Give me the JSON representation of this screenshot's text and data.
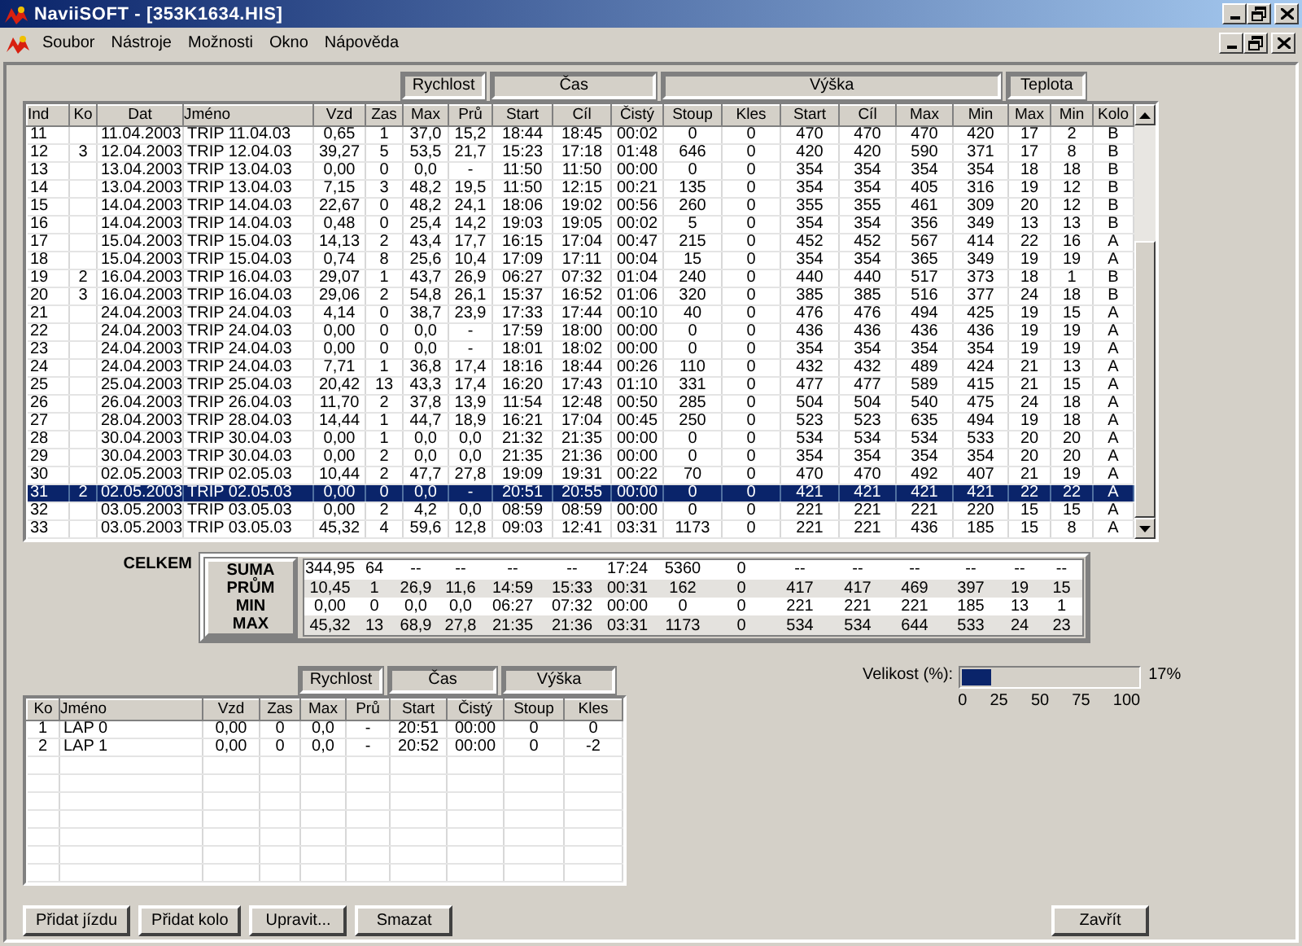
{
  "window": {
    "title": "NaviiSOFT - [353K1634.HIS]"
  },
  "menu": [
    "Soubor",
    "Nástroje",
    "Možnosti",
    "Okno",
    "Nápověda"
  ],
  "trips": {
    "groups": [
      "Rychlost",
      "Čas",
      "Výška",
      "Teplota"
    ],
    "columns": [
      "Ind",
      "Ko",
      "Dat",
      "Jméno",
      "Vzd",
      "Zas",
      "Max",
      "Prů",
      "Start",
      "Cíl",
      "Čistý",
      "Stoup",
      "Kles",
      "Start",
      "Cíl",
      "Max",
      "Min",
      "Max",
      "Min",
      "Kolo"
    ],
    "rows": [
      {
        "selected": false,
        "cells": [
          "11",
          null,
          "11.04.2003",
          "TRIP 11.04.03",
          "0,65",
          "1",
          "37,0",
          "15,2",
          "18:44",
          "18:45",
          "00:02",
          "0",
          "0",
          "470",
          "470",
          "470",
          "420",
          "17",
          "2",
          "B"
        ]
      },
      {
        "selected": false,
        "cells": [
          "12",
          "3",
          "12.04.2003",
          "TRIP 12.04.03",
          "39,27",
          "5",
          "53,5",
          "21,7",
          "15:23",
          "17:18",
          "01:48",
          "646",
          "0",
          "420",
          "420",
          "590",
          "371",
          "17",
          "8",
          "B"
        ]
      },
      {
        "selected": false,
        "cells": [
          "13",
          null,
          "13.04.2003",
          "TRIP 13.04.03",
          "0,00",
          "0",
          "0,0",
          "-",
          "11:50",
          "11:50",
          "00:00",
          "0",
          "0",
          "354",
          "354",
          "354",
          "354",
          "18",
          "18",
          "B"
        ]
      },
      {
        "selected": false,
        "cells": [
          "14",
          null,
          "13.04.2003",
          "TRIP 13.04.03",
          "7,15",
          "3",
          "48,2",
          "19,5",
          "11:50",
          "12:15",
          "00:21",
          "135",
          "0",
          "354",
          "354",
          "405",
          "316",
          "19",
          "12",
          "B"
        ]
      },
      {
        "selected": false,
        "cells": [
          "15",
          null,
          "14.04.2003",
          "TRIP 14.04.03",
          "22,67",
          "0",
          "48,2",
          "24,1",
          "18:06",
          "19:02",
          "00:56",
          "260",
          "0",
          "355",
          "355",
          "461",
          "309",
          "20",
          "12",
          "B"
        ]
      },
      {
        "selected": false,
        "cells": [
          "16",
          null,
          "14.04.2003",
          "TRIP 14.04.03",
          "0,48",
          "0",
          "25,4",
          "14,2",
          "19:03",
          "19:05",
          "00:02",
          "5",
          "0",
          "354",
          "354",
          "356",
          "349",
          "13",
          "13",
          "B"
        ]
      },
      {
        "selected": false,
        "cells": [
          "17",
          null,
          "15.04.2003",
          "TRIP 15.04.03",
          "14,13",
          "2",
          "43,4",
          "17,7",
          "16:15",
          "17:04",
          "00:47",
          "215",
          "0",
          "452",
          "452",
          "567",
          "414",
          "22",
          "16",
          "A"
        ]
      },
      {
        "selected": false,
        "cells": [
          "18",
          null,
          "15.04.2003",
          "TRIP 15.04.03",
          "0,74",
          "8",
          "25,6",
          "10,4",
          "17:09",
          "17:11",
          "00:04",
          "15",
          "0",
          "354",
          "354",
          "365",
          "349",
          "19",
          "19",
          "A"
        ]
      },
      {
        "selected": false,
        "cells": [
          "19",
          "2",
          "16.04.2003",
          "TRIP 16.04.03",
          "29,07",
          "1",
          "43,7",
          "26,9",
          "06:27",
          "07:32",
          "01:04",
          "240",
          "0",
          "440",
          "440",
          "517",
          "373",
          "18",
          "1",
          "B"
        ]
      },
      {
        "selected": false,
        "cells": [
          "20",
          "3",
          "16.04.2003",
          "TRIP 16.04.03",
          "29,06",
          "2",
          "54,8",
          "26,1",
          "15:37",
          "16:52",
          "01:06",
          "320",
          "0",
          "385",
          "385",
          "516",
          "377",
          "24",
          "18",
          "B"
        ]
      },
      {
        "selected": false,
        "cells": [
          "21",
          null,
          "24.04.2003",
          "TRIP 24.04.03",
          "4,14",
          "0",
          "38,7",
          "23,9",
          "17:33",
          "17:44",
          "00:10",
          "40",
          "0",
          "476",
          "476",
          "494",
          "425",
          "19",
          "15",
          "A"
        ]
      },
      {
        "selected": false,
        "cells": [
          "22",
          null,
          "24.04.2003",
          "TRIP 24.04.03",
          "0,00",
          "0",
          "0,0",
          "-",
          "17:59",
          "18:00",
          "00:00",
          "0",
          "0",
          "436",
          "436",
          "436",
          "436",
          "19",
          "19",
          "A"
        ]
      },
      {
        "selected": false,
        "cells": [
          "23",
          null,
          "24.04.2003",
          "TRIP 24.04.03",
          "0,00",
          "0",
          "0,0",
          "-",
          "18:01",
          "18:02",
          "00:00",
          "0",
          "0",
          "354",
          "354",
          "354",
          "354",
          "19",
          "19",
          "A"
        ]
      },
      {
        "selected": false,
        "cells": [
          "24",
          null,
          "24.04.2003",
          "TRIP 24.04.03",
          "7,71",
          "1",
          "36,8",
          "17,4",
          "18:16",
          "18:44",
          "00:26",
          "110",
          "0",
          "432",
          "432",
          "489",
          "424",
          "21",
          "13",
          "A"
        ]
      },
      {
        "selected": false,
        "cells": [
          "25",
          null,
          "25.04.2003",
          "TRIP 25.04.03",
          "20,42",
          "13",
          "43,3",
          "17,4",
          "16:20",
          "17:43",
          "01:10",
          "331",
          "0",
          "477",
          "477",
          "589",
          "415",
          "21",
          "15",
          "A"
        ]
      },
      {
        "selected": false,
        "cells": [
          "26",
          null,
          "26.04.2003",
          "TRIP 26.04.03",
          "11,70",
          "2",
          "37,8",
          "13,9",
          "11:54",
          "12:48",
          "00:50",
          "285",
          "0",
          "504",
          "504",
          "540",
          "475",
          "24",
          "18",
          "A"
        ]
      },
      {
        "selected": false,
        "cells": [
          "27",
          null,
          "28.04.2003",
          "TRIP 28.04.03",
          "14,44",
          "1",
          "44,7",
          "18,9",
          "16:21",
          "17:04",
          "00:45",
          "250",
          "0",
          "523",
          "523",
          "635",
          "494",
          "19",
          "18",
          "A"
        ]
      },
      {
        "selected": false,
        "cells": [
          "28",
          null,
          "30.04.2003",
          "TRIP 30.04.03",
          "0,00",
          "1",
          "0,0",
          "0,0",
          "21:32",
          "21:35",
          "00:00",
          "0",
          "0",
          "534",
          "534",
          "534",
          "533",
          "20",
          "20",
          "A"
        ]
      },
      {
        "selected": false,
        "cells": [
          "29",
          null,
          "30.04.2003",
          "TRIP 30.04.03",
          "0,00",
          "2",
          "0,0",
          "0,0",
          "21:35",
          "21:36",
          "00:00",
          "0",
          "0",
          "354",
          "354",
          "354",
          "354",
          "20",
          "20",
          "A"
        ]
      },
      {
        "selected": false,
        "cells": [
          "30",
          null,
          "02.05.2003",
          "TRIP 02.05.03",
          "10,44",
          "2",
          "47,7",
          "27,8",
          "19:09",
          "19:31",
          "00:22",
          "70",
          "0",
          "470",
          "470",
          "492",
          "407",
          "21",
          "19",
          "A"
        ]
      },
      {
        "selected": true,
        "cells": [
          "31",
          "2",
          "02.05.2003",
          "TRIP 02.05.03",
          "0,00",
          "0",
          "0,0",
          "-",
          "20:51",
          "20:55",
          "00:00",
          "0",
          "0",
          "421",
          "421",
          "421",
          "421",
          "22",
          "22",
          "A"
        ]
      },
      {
        "selected": false,
        "cells": [
          "32",
          null,
          "03.05.2003",
          "TRIP 03.05.03",
          "0,00",
          "2",
          "4,2",
          "0,0",
          "08:59",
          "08:59",
          "00:00",
          "0",
          "0",
          "221",
          "221",
          "221",
          "220",
          "15",
          "15",
          "A"
        ]
      },
      {
        "selected": false,
        "cells": [
          "33",
          null,
          "03.05.2003",
          "TRIP 03.05.03",
          "45,32",
          "4",
          "59,6",
          "12,8",
          "09:03",
          "12:41",
          "03:31",
          "1173",
          "0",
          "221",
          "221",
          "436",
          "185",
          "15",
          "8",
          "A"
        ]
      }
    ]
  },
  "totals": {
    "title": "CELKEM",
    "rows": [
      {
        "label": "SUMA",
        "values": [
          "344,95",
          "64",
          "--",
          "--",
          "--",
          "--",
          "17:24",
          "5360",
          "0",
          "--",
          "--",
          "--",
          "--",
          "--",
          "--"
        ]
      },
      {
        "label": "PRŮM",
        "values": [
          "10,45",
          "1",
          "26,9",
          "11,6",
          "14:59",
          "15:33",
          "00:31",
          "162",
          "0",
          "417",
          "417",
          "469",
          "397",
          "19",
          "15"
        ]
      },
      {
        "label": "MIN",
        "values": [
          "0,00",
          "0",
          "0,0",
          "0,0",
          "06:27",
          "07:32",
          "00:00",
          "0",
          "0",
          "221",
          "221",
          "221",
          "185",
          "13",
          "1"
        ]
      },
      {
        "label": "MAX",
        "values": [
          "45,32",
          "13",
          "68,9",
          "27,8",
          "21:35",
          "21:36",
          "03:31",
          "1173",
          "0",
          "534",
          "534",
          "644",
          "533",
          "24",
          "23"
        ]
      }
    ]
  },
  "laps": {
    "groups": [
      "Rychlost",
      "Čas",
      "Výška"
    ],
    "columns": [
      "Ko",
      "Jméno",
      "Vzd",
      "Zas",
      "Max",
      "Prů",
      "Start",
      "Čistý",
      "Stoup",
      "Kles"
    ],
    "rows": [
      {
        "cells": [
          "1",
          "LAP 0",
          "0,00",
          "0",
          "0,0",
          "-",
          "20:51",
          "00:00",
          "0",
          "0"
        ]
      },
      {
        "cells": [
          "2",
          "LAP 1",
          "0,00",
          "0",
          "0,0",
          "-",
          "20:52",
          "00:00",
          "0",
          "-2"
        ]
      }
    ]
  },
  "size": {
    "label": "Velikost (%):",
    "level": 0.17,
    "reading": "17%",
    "ticks": [
      "0",
      "25",
      "50",
      "75",
      "100"
    ]
  },
  "buttons": [
    "Přidat jízdu",
    "Přidat kolo",
    "Upravit...",
    "Smazat"
  ],
  "close_button": "Zavřít"
}
